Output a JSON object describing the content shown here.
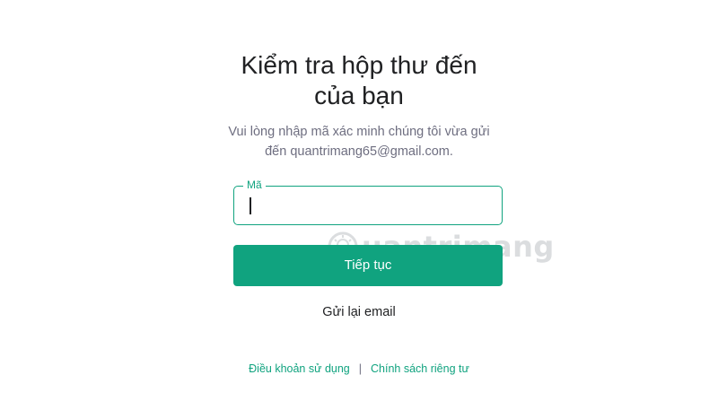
{
  "heading": {
    "line1": "Kiểm tra hộp thư đến",
    "line2": "của bạn"
  },
  "subtitle": {
    "line1": "Vui lòng nhập mã xác minh chúng tôi vừa gửi",
    "line2": "đến quantrimang65@gmail.com."
  },
  "code_field": {
    "label": "Mã",
    "value": ""
  },
  "continue_button": {
    "label": "Tiếp tục"
  },
  "resend_link": {
    "label": "Gửi lại email"
  },
  "footer": {
    "terms": "Điều khoản sử dụng",
    "separator": "|",
    "privacy": "Chính sách riêng tư"
  },
  "watermark": {
    "text": "uantrimang"
  },
  "colors": {
    "accent": "#10a37f",
    "text": "#202123",
    "muted": "#6e6e80"
  }
}
